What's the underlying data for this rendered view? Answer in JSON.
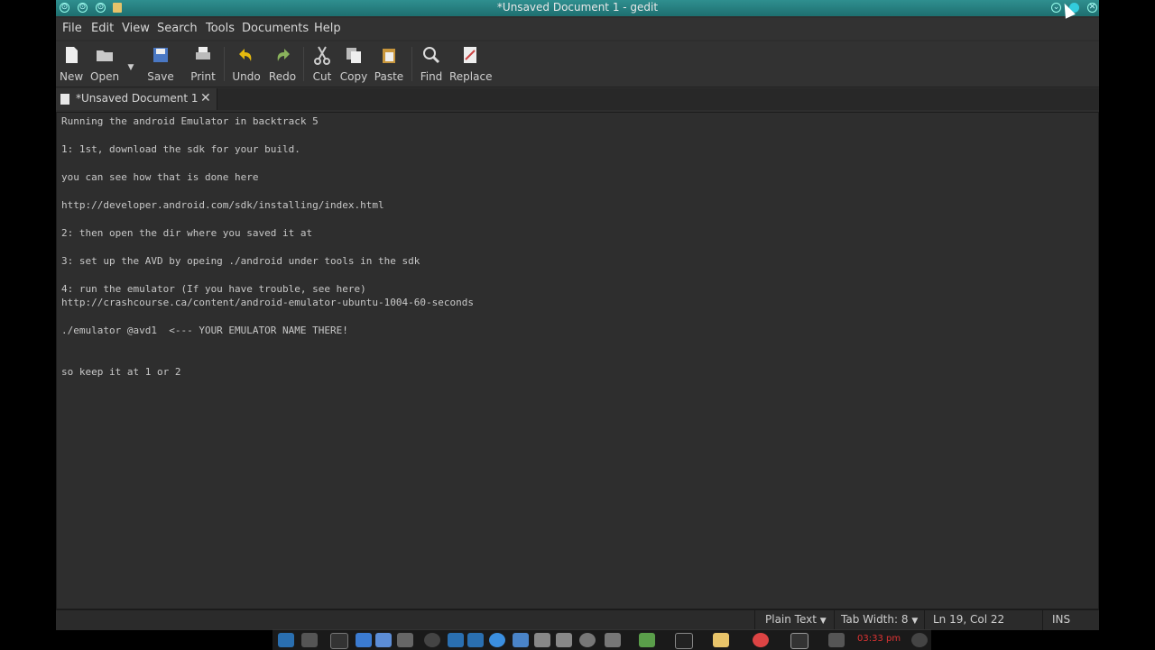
{
  "window": {
    "title": "*Unsaved Document 1 - gedit"
  },
  "menu": [
    "File",
    "Edit",
    "View",
    "Search",
    "Tools",
    "Documents",
    "Help"
  ],
  "toolbar": {
    "new": "New",
    "open": "Open",
    "save": "Save",
    "print": "Print",
    "undo": "Undo",
    "redo": "Redo",
    "cut": "Cut",
    "copy": "Copy",
    "paste": "Paste",
    "find": "Find",
    "replace": "Replace"
  },
  "tab": {
    "label": "*Unsaved Document 1",
    "close": "✕"
  },
  "editor": {
    "lines": [
      "Running the android Emulator in backtrack 5",
      "1: 1st, download the sdk for your build.",
      "you can see how that is done here",
      "http://developer.android.com/sdk/installing/index.html",
      "2: then open the dir where you saved it at",
      "3: set up the AVD by opeing ./android under tools in the sdk",
      "4: run the emulator (If you have trouble, see here)",
      "http://crashcourse.ca/content/android-emulator-ubuntu-1004-60-seconds",
      "./emulator @avd1  <--- YOUR EMULATOR NAME THERE!",
      "so keep it at 1 or 2"
    ]
  },
  "status": {
    "language": "Plain Text",
    "tab_width": "Tab Width: 8",
    "position": "Ln 19, Col 22",
    "mode": "INS"
  },
  "taskbar": {
    "clock": "03:33 pm"
  },
  "colors": {
    "titlebar": "#1e6f70",
    "editor_bg": "#2e2e2e",
    "text": "#c8c8c8",
    "clock": "#dd3333"
  }
}
